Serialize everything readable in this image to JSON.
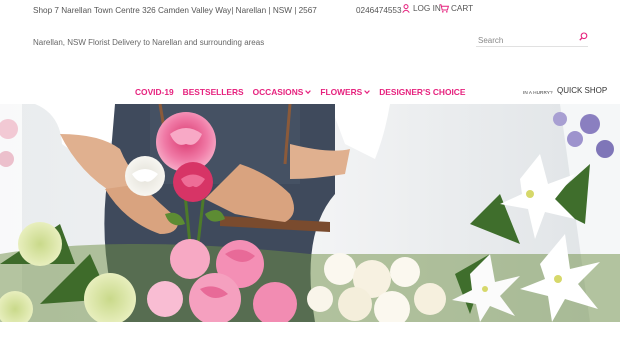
{
  "header": {
    "address": "Shop 7 Narellan Town Centre 326 Camden Valley Way| Narellan | NSW | 2567",
    "phone": "0246474553",
    "login_label": "LOG IN",
    "cart_label": "CART",
    "tagline": "Narellan, NSW Florist Delivery to Narellan and surrounding areas"
  },
  "search": {
    "placeholder": "Search"
  },
  "nav": {
    "items": [
      {
        "label": "COVID-19",
        "has_dropdown": false
      },
      {
        "label": "BESTSELLERS",
        "has_dropdown": false
      },
      {
        "label": "OCCASIONS",
        "has_dropdown": true
      },
      {
        "label": "FLOWERS",
        "has_dropdown": true
      },
      {
        "label": "DESIGNER'S CHOICE",
        "has_dropdown": false
      }
    ]
  },
  "quickshop": {
    "hint": "IN A HURRY?",
    "label": "QUICK SHOP"
  },
  "colors": {
    "accent": "#e6227e",
    "text": "#555555",
    "apron": "#3f4a5c",
    "rose": "#f07aa6"
  },
  "icons": [
    "person-icon",
    "cart-icon",
    "search-icon",
    "chevron-down-icon"
  ]
}
